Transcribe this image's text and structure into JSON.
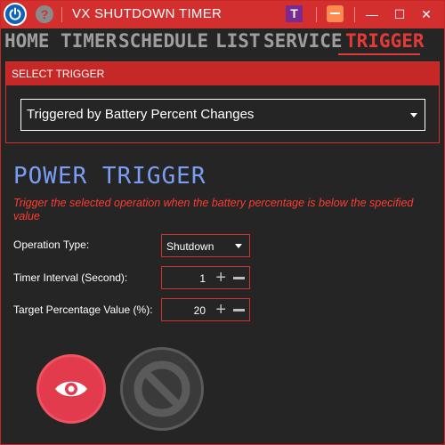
{
  "window": {
    "title": "VX SHUTDOWN TIMER",
    "help_glyph": "?",
    "t_glyph": "T",
    "minimize_glyph": "—",
    "maximize_glyph": "☐",
    "close_glyph": "✕",
    "accent_color": "#d32f2f",
    "power_button_color": "#0d63b8"
  },
  "nav": {
    "items": [
      {
        "label": "HOME"
      },
      {
        "label": "TIMER"
      },
      {
        "label": "SCHEDULE"
      },
      {
        "label": "LIST"
      },
      {
        "label": "SERVICE"
      },
      {
        "label": "TRIGGER",
        "active": true
      }
    ]
  },
  "select_trigger": {
    "header": "SELECT TRIGGER",
    "selected": "Triggered by Battery Percent Changes"
  },
  "power_trigger": {
    "title": "POWER TRIGGER",
    "description": "Trigger the selected operation when the battery percentage is below the specified value",
    "fields": {
      "operation_type": {
        "label": "Operation Type:",
        "value": "Shutdown"
      },
      "timer_interval": {
        "label": "Timer Interval (Second):",
        "value": "1"
      },
      "target_percentage": {
        "label": "Target Percentage Value (%):",
        "value": "20"
      }
    }
  },
  "icons": {
    "power": "power-icon",
    "help": "help-icon",
    "eye": "eye-icon",
    "cancel": "prohibit-icon"
  }
}
